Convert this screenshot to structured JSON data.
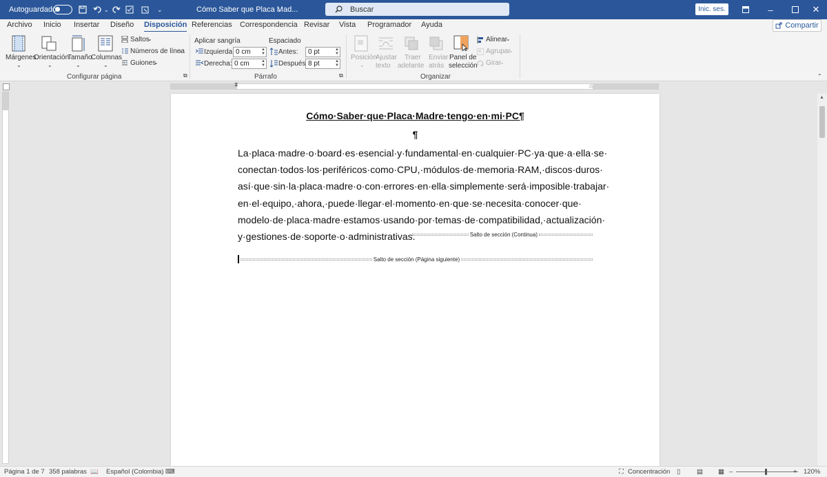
{
  "titlebar": {
    "autosave_label": "Autoguardado",
    "doc_title": "Cómo Saber que Placa Mad...",
    "search_placeholder": "Buscar",
    "signin_label": "Inic. ses."
  },
  "tabs": [
    "Archivo",
    "Inicio",
    "Insertar",
    "Diseño",
    "Disposición",
    "Referencias",
    "Correspondencia",
    "Revisar",
    "Vista",
    "Programador",
    "Ayuda"
  ],
  "active_tab": "Disposición",
  "share_label": "Compartir",
  "ribbon": {
    "page_setup": {
      "margins": "Márgenes",
      "orientation": "Orientación",
      "size": "Tamaño",
      "columns": "Columnas",
      "breaks": "Saltos",
      "line_numbers": "Números de línea",
      "hyphenation": "Guiones",
      "group_label": "Configurar página"
    },
    "paragraph": {
      "indent_header": "Aplicar sangría",
      "spacing_header": "Espaciado",
      "left_label": "Izquierda:",
      "left_value": "0 cm",
      "right_label": "Derecha:",
      "right_value": "0 cm",
      "before_label": "Antes:",
      "before_value": "0 pt",
      "after_label": "Después:",
      "after_value": "8 pt",
      "group_label": "Párrafo"
    },
    "arrange": {
      "position_1": "Posición",
      "wrap_1": "Ajustar",
      "wrap_2": "texto",
      "forward_1": "Traer",
      "forward_2": "adelante",
      "backward_1": "Enviar",
      "backward_2": "atrás",
      "selection_1": "Panel de",
      "selection_2": "selección",
      "align": "Alinear",
      "group": "Agrupar",
      "rotate": "Girar",
      "group_label": "Organizar"
    }
  },
  "document": {
    "title": "Cómo·Saber·que·Placa·Madre·tengo·en·mi·PC¶",
    "empty_paragraph": "¶",
    "paragraph": "La·placa·madre·o·board·es·esencial·y·fundamental·en·cualquier·PC·ya·que·a·ella·se· conectan·todos·los·periféricos·como·CPU,·módulos·de·memoria·RAM,·discos·duros· así·que·sin·la·placa·madre·o·con·errores·en·ella·simplemente·será·imposible·trabajar· en·el·equipo,·ahora,·puede·llegar·el·momento·en·que·se·necesita·conocer·que· modelo·de·placa·madre·estamos·usando·por·temas·de·compatibilidad,·actualización· y·gestiones·de·soporte·o·administrativas.",
    "section_break_continuous": "Salto de sección (Continua)",
    "section_break_next_page": "Salto de sección (Página siguiente)"
  },
  "status": {
    "page": "Página 1 de 7",
    "words": "358 palabras",
    "language": "Español (Colombia)",
    "focus": "Concentración",
    "zoom": "120%"
  },
  "colors": {
    "accent": "#2b579a",
    "ribbon_bg": "#f3f3f3",
    "canvas_bg": "#e6e6e6"
  }
}
